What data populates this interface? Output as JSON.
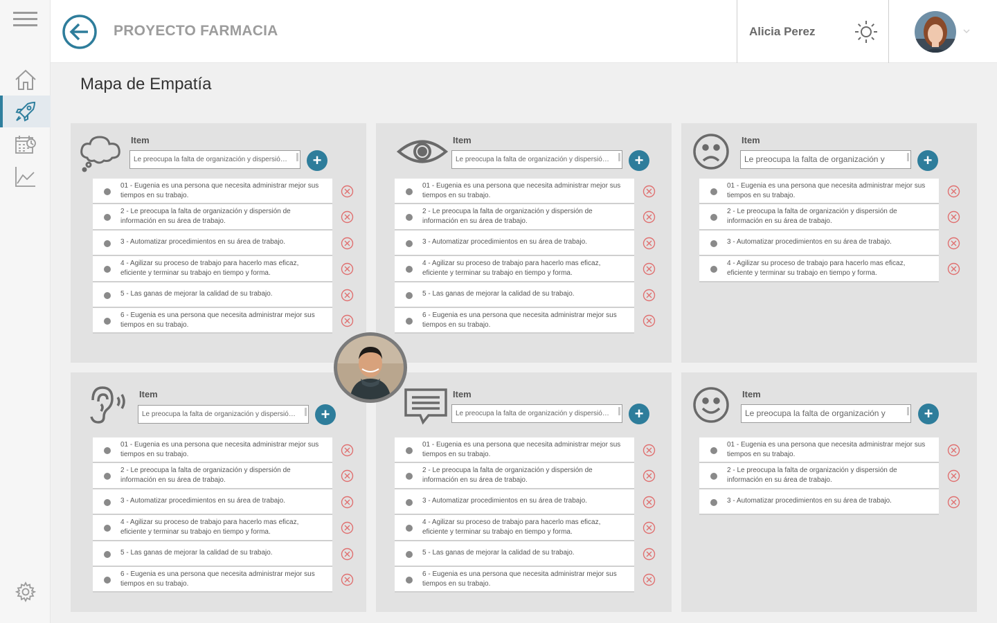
{
  "header": {
    "project_title": "PROYECTO FARMACIA",
    "user_name": "Alicia Perez"
  },
  "page": {
    "title": "Mapa de Empatía"
  },
  "sidebar": {
    "items": [
      {
        "icon": "menu-icon"
      },
      {
        "icon": "home-icon"
      },
      {
        "icon": "rocket-icon",
        "active": true
      },
      {
        "icon": "calendar-clock-icon"
      },
      {
        "icon": "chart-icon"
      },
      {
        "icon": "gear-icon"
      }
    ]
  },
  "colors": {
    "accent": "#2e7d9b",
    "delete": "#e07070"
  },
  "panels": [
    {
      "icon": "thought-cloud-icon",
      "item_label": "Item",
      "input_value": "Le preocupa la falta de organización y dispersión de...",
      "rows": [
        "01 - Eugenia es una persona que necesita administrar mejor sus tiempos en su trabajo.",
        "2 - Le preocupa la falta de organización y dispersión de información en su área de trabajo.",
        "3 - Automatizar procedimientos en su área de trabajo.",
        "4 - Agilizar su proceso de trabajo para hacerlo mas eficaz, eficiente y terminar su trabajo en tiempo y forma.",
        "5 - Las ganas de mejorar la calidad de su trabajo.",
        "6 - Eugenia es una persona que necesita administrar mejor sus tiempos en su trabajo."
      ]
    },
    {
      "icon": "eye-icon",
      "item_label": "Item",
      "input_value": "Le preocupa la falta de organización y dispersión de...",
      "rows": [
        "01 - Eugenia es una persona que necesita administrar mejor sus tiempos en su trabajo.",
        "2 - Le preocupa la falta de organización y dispersión de información en su área de trabajo.",
        "3 - Automatizar procedimientos en su área de trabajo.",
        "4 - Agilizar su proceso de trabajo para hacerlo mas eficaz, eficiente y terminar su trabajo en tiempo y forma.",
        "5 - Las ganas de mejorar la calidad de su trabajo.",
        "6 - Eugenia es una persona que necesita administrar mejor sus tiempos en su trabajo."
      ]
    },
    {
      "icon": "sad-face-icon",
      "item_label": "Item",
      "input_value": "Le preocupa la falta de organización y",
      "rows": [
        "01 - Eugenia es una persona que necesita administrar mejor sus tiempos en su trabajo.",
        "2 - Le preocupa la falta de organización y dispersión de información en su área de trabajo.",
        "3 - Automatizar procedimientos en su área de trabajo.",
        "4 - Agilizar su proceso de trabajo para hacerlo mas eficaz, eficiente y terminar su trabajo en tiempo y forma."
      ]
    },
    {
      "icon": "ear-icon",
      "item_label": "Item",
      "input_value": "Le preocupa la falta de organización y dispersión de",
      "rows": [
        "01 - Eugenia es una persona que necesita administrar mejor sus tiempos en su trabajo.",
        "2 - Le preocupa la falta de organización y dispersión de información en su área de trabajo.",
        "3 - Automatizar procedimientos en su área de trabajo.",
        "4 - Agilizar su proceso de trabajo para hacerlo mas eficaz, eficiente y terminar su trabajo en tiempo y forma.",
        "5 - Las ganas de mejorar la calidad de su trabajo.",
        "6 - Eugenia es una persona que necesita administrar mejor sus tiempos en su trabajo."
      ]
    },
    {
      "icon": "speech-bubble-icon",
      "item_label": "Item",
      "input_value": "Le preocupa la falta de organización y dispersión de",
      "rows": [
        "01 - Eugenia es una persona que necesita administrar mejor sus tiempos en su trabajo.",
        "2 - Le preocupa la falta de organización y dispersión de información en su área de trabajo.",
        "3 - Automatizar procedimientos en su área de trabajo.",
        "4 - Agilizar su proceso de trabajo para hacerlo mas eficaz, eficiente y terminar su trabajo en tiempo y forma.",
        "5 - Las ganas de mejorar la calidad de su trabajo.",
        "6 - Eugenia es una persona que necesita administrar mejor sus tiempos en su trabajo."
      ]
    },
    {
      "icon": "happy-face-icon",
      "item_label": "Item",
      "input_value": "Le preocupa la falta de organización y",
      "rows": [
        "01 - Eugenia es una persona que necesita administrar mejor sus tiempos en su trabajo.",
        "2 - Le preocupa la falta de organización y dispersión de información en su área de trabajo.",
        "3 - Automatizar procedimientos en su área de trabajo."
      ]
    }
  ]
}
